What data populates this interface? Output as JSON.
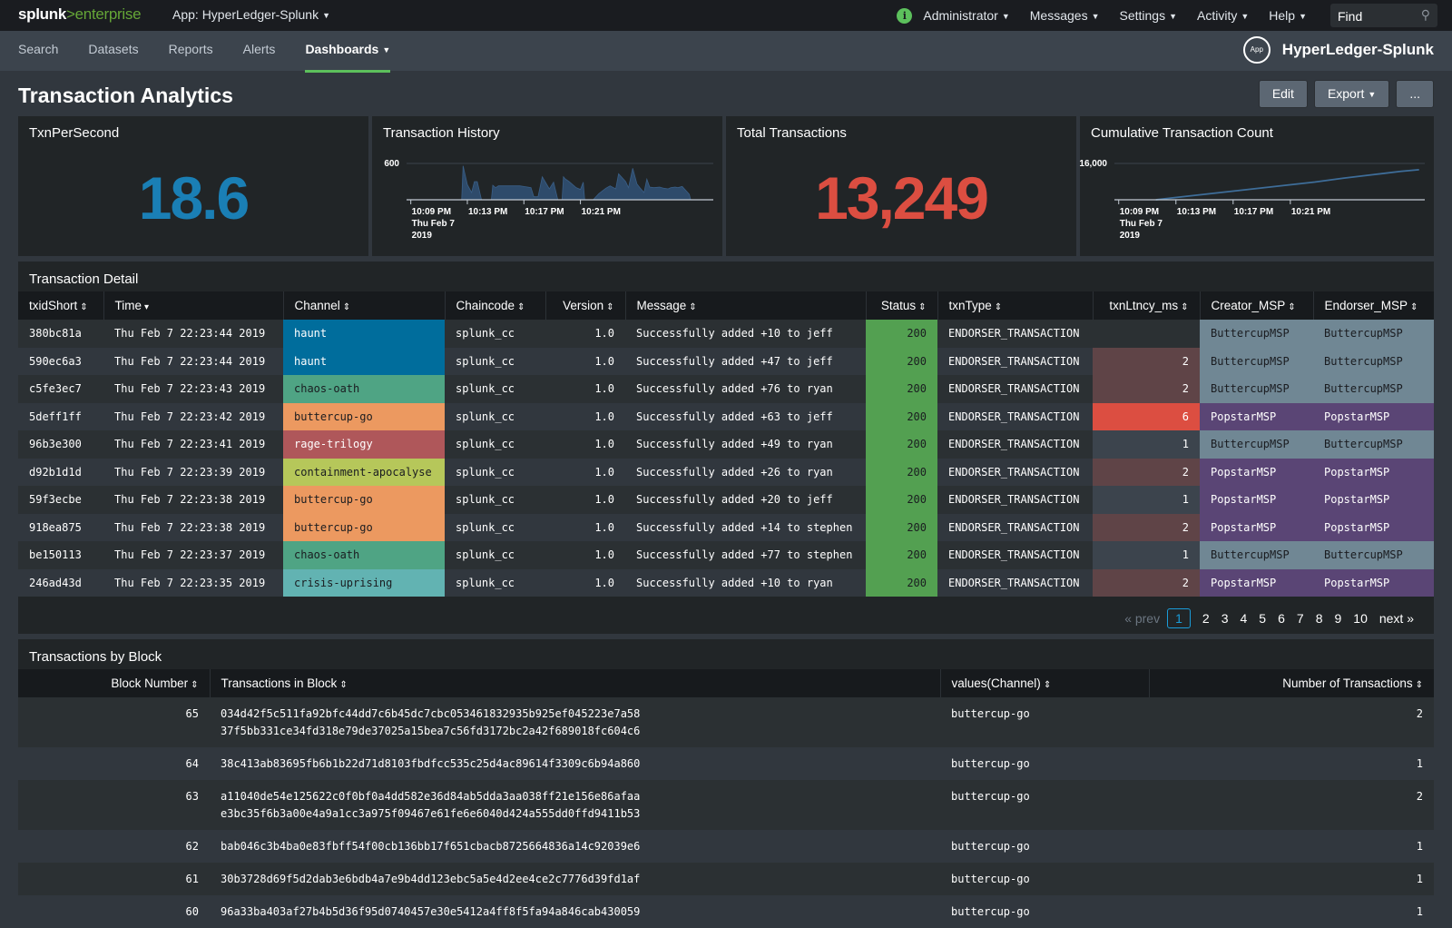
{
  "topbar": {
    "logo_main": "splunk",
    "logo_sep": ">",
    "logo_product": "enterprise",
    "app_switcher": "App: HyperLedger-Splunk",
    "nav": [
      "Administrator",
      "Messages",
      "Settings",
      "Activity",
      "Help"
    ],
    "find_placeholder": "Find"
  },
  "appbar": {
    "tabs": [
      "Search",
      "Datasets",
      "Reports",
      "Alerts",
      "Dashboards"
    ],
    "active_tab": "Dashboards",
    "app_badge": "App",
    "app_name": "HyperLedger-Splunk"
  },
  "dashboard": {
    "title": "Transaction Analytics",
    "buttons": {
      "edit": "Edit",
      "export": "Export",
      "more": "..."
    }
  },
  "panels": {
    "tps": {
      "title": "TxnPerSecond",
      "value": "18.6",
      "color": "#1a7fb5"
    },
    "history": {
      "title": "Transaction History"
    },
    "total": {
      "title": "Total Transactions",
      "value": "13,249",
      "color": "#dc4e41"
    },
    "cumulative": {
      "title": "Cumulative Transaction Count"
    }
  },
  "chart_data": [
    {
      "type": "area",
      "title": "Transaction History",
      "ylim": [
        0,
        600
      ],
      "yticks": [
        "600"
      ],
      "xticks": [
        [
          "10:09 PM",
          "Thu Feb 7",
          "2019"
        ],
        [
          "10:13 PM"
        ],
        [
          "10:17 PM"
        ],
        [
          "10:21 PM"
        ]
      ],
      "x_minutes": [
        0,
        3.9,
        4.0,
        4.3,
        4.6,
        4.8,
        5.0,
        5.3,
        5.5,
        6.0,
        6.1,
        6.3,
        6.5,
        7.0,
        8.0,
        8.8,
        9.0,
        9.3,
        9.6,
        9.8,
        10.1,
        10.4,
        10.7,
        11.0,
        11.1,
        11.2,
        11.5,
        12.0,
        12.3,
        12.5,
        12.6,
        13.0,
        13.2,
        13.6,
        14.1,
        14.4,
        14.8,
        15.0,
        15.5,
        15.7,
        16.0,
        16.3,
        16.5,
        16.8,
        17.0,
        17.2,
        17.5,
        17.9,
        18.2,
        18.5,
        18.7,
        19.0,
        19.2,
        19.5,
        20.0,
        20.1
      ],
      "values": [
        0,
        0,
        560,
        250,
        120,
        300,
        300,
        0,
        0,
        0,
        240,
        200,
        230,
        230,
        230,
        200,
        50,
        50,
        380,
        300,
        180,
        290,
        0,
        0,
        380,
        350,
        300,
        200,
        170,
        290,
        0,
        0,
        0,
        100,
        190,
        230,
        180,
        430,
        300,
        200,
        520,
        260,
        200,
        120,
        340,
        210,
        200,
        210,
        190,
        180,
        200,
        210,
        200,
        220,
        90,
        0
      ],
      "color": "#2e4b6b"
    },
    {
      "type": "line",
      "title": "Cumulative Transaction Count",
      "ylim": [
        0,
        16000
      ],
      "yticks": [
        "16,000"
      ],
      "xticks": [
        [
          "10:09 PM",
          "Thu Feb 7",
          "2019"
        ],
        [
          "10:13 PM"
        ],
        [
          "10:17 PM"
        ],
        [
          "10:21 PM"
        ]
      ],
      "x_minutes": [
        2.9,
        4,
        6,
        8,
        10,
        12,
        14,
        16,
        18,
        20,
        21.3
      ],
      "values": [
        0,
        800,
        2200,
        3600,
        5000,
        6400,
        7800,
        9500,
        11000,
        12500,
        13249
      ],
      "color": "#3e6d99"
    }
  ],
  "transaction_detail": {
    "title": "Transaction Detail",
    "columns": [
      "txidShort",
      "Time",
      "Channel",
      "Chaincode",
      "Version",
      "Message",
      "Status",
      "txnType",
      "txnLtncy_ms",
      "Creator_MSP",
      "Endorser_MSP"
    ],
    "rows": [
      [
        "380bc81a",
        "Thu Feb  7 22:23:44 2019",
        "haunt",
        "splunk_cc",
        "1.0",
        "Successfully added +10 to jeff",
        "200",
        "ENDORSER_TRANSACTION",
        "",
        "ButtercupMSP",
        "ButtercupMSP"
      ],
      [
        "590ec6a3",
        "Thu Feb  7 22:23:44 2019",
        "haunt",
        "splunk_cc",
        "1.0",
        "Successfully added +47 to jeff",
        "200",
        "ENDORSER_TRANSACTION",
        "2",
        "ButtercupMSP",
        "ButtercupMSP"
      ],
      [
        "c5fe3ec7",
        "Thu Feb  7 22:23:43 2019",
        "chaos-oath",
        "splunk_cc",
        "1.0",
        "Successfully added +76 to ryan",
        "200",
        "ENDORSER_TRANSACTION",
        "2",
        "ButtercupMSP",
        "ButtercupMSP"
      ],
      [
        "5deff1ff",
        "Thu Feb  7 22:23:42 2019",
        "buttercup-go",
        "splunk_cc",
        "1.0",
        "Successfully added +63 to jeff",
        "200",
        "ENDORSER_TRANSACTION",
        "6",
        "PopstarMSP",
        "PopstarMSP"
      ],
      [
        "96b3e300",
        "Thu Feb  7 22:23:41 2019",
        "rage-trilogy",
        "splunk_cc",
        "1.0",
        "Successfully added +49 to ryan",
        "200",
        "ENDORSER_TRANSACTION",
        "1",
        "ButtercupMSP",
        "ButtercupMSP"
      ],
      [
        "d92b1d1d",
        "Thu Feb  7 22:23:39 2019",
        "containment-apocalyse",
        "splunk_cc",
        "1.0",
        "Successfully added +26 to ryan",
        "200",
        "ENDORSER_TRANSACTION",
        "2",
        "PopstarMSP",
        "PopstarMSP"
      ],
      [
        "59f3ecbe",
        "Thu Feb  7 22:23:38 2019",
        "buttercup-go",
        "splunk_cc",
        "1.0",
        "Successfully added +20 to jeff",
        "200",
        "ENDORSER_TRANSACTION",
        "1",
        "PopstarMSP",
        "PopstarMSP"
      ],
      [
        "918ea875",
        "Thu Feb  7 22:23:38 2019",
        "buttercup-go",
        "splunk_cc",
        "1.0",
        "Successfully added +14 to stephen",
        "200",
        "ENDORSER_TRANSACTION",
        "2",
        "PopstarMSP",
        "PopstarMSP"
      ],
      [
        "be150113",
        "Thu Feb  7 22:23:37 2019",
        "chaos-oath",
        "splunk_cc",
        "1.0",
        "Successfully added +77 to stephen",
        "200",
        "ENDORSER_TRANSACTION",
        "1",
        "ButtercupMSP",
        "ButtercupMSP"
      ],
      [
        "246ad43d",
        "Thu Feb  7 22:23:35 2019",
        "crisis-uprising",
        "splunk_cc",
        "1.0",
        "Successfully added +10 to ryan",
        "200",
        "ENDORSER_TRANSACTION",
        "2",
        "PopstarMSP",
        "PopstarMSP"
      ]
    ],
    "channel_colors": {
      "haunt": [
        "#006d9c",
        "#ffffff"
      ],
      "chaos-oath": [
        "#4fa484",
        "#1a1c20"
      ],
      "buttercup-go": [
        "#ec9960",
        "#1a1c20"
      ],
      "rage-trilogy": [
        "#af575a",
        "#ffffff"
      ],
      "containment-apocalyse": [
        "#b6c75a",
        "#1a1c20"
      ],
      "crisis-uprising": [
        "#62b3b2",
        "#1a1c20"
      ]
    },
    "status_color": "#53a051",
    "latency_colors": {
      "1": "#3c444d",
      "2": "#5f4447",
      "6": "#dc4e41"
    },
    "msp_colors": {
      "ButtercupMSP": [
        "#708794",
        "#1a1c20"
      ],
      "PopstarMSP": [
        "#5a4575",
        "#ffffff"
      ]
    },
    "pagination": {
      "prev": "« prev",
      "pages": [
        "1",
        "2",
        "3",
        "4",
        "5",
        "6",
        "7",
        "8",
        "9",
        "10"
      ],
      "current": "1",
      "next": "next »"
    }
  },
  "transactions_by_block": {
    "title": "Transactions by Block",
    "columns": [
      "Block Number",
      "Transactions in Block",
      "values(Channel)",
      "Number of Transactions"
    ],
    "rows": [
      {
        "block": "65",
        "txns": [
          "034d42f5c511fa92bfc44dd7c6b45dc7cbc053461832935b925ef045223e7a58",
          "37f5bb331ce34fd318e79de37025a15bea7c56fd3172bc2a42f689018fc604c6"
        ],
        "channel": "buttercup-go",
        "count": "2"
      },
      {
        "block": "64",
        "txns": [
          "38c413ab83695fb6b1b22d71d8103fbdfcc535c25d4ac89614f3309c6b94a860"
        ],
        "channel": "buttercup-go",
        "count": "1"
      },
      {
        "block": "63",
        "txns": [
          "a11040de54e125622c0f0bf0a4dd582e36d84ab5dda3aa038ff21e156e86afaa",
          "e3bc35f6b3a00e4a9a1cc3a975f09467e61fe6e6040d424a555dd0ffd9411b53"
        ],
        "channel": "buttercup-go",
        "count": "2"
      },
      {
        "block": "62",
        "txns": [
          "bab046c3b4ba0e83fbff54f00cb136bb17f651cbacb8725664836a14c92039e6"
        ],
        "channel": "buttercup-go",
        "count": "1"
      },
      {
        "block": "61",
        "txns": [
          "30b3728d69f5d2dab3e6bdb4a7e9b4dd123ebc5a5e4d2ee4ce2c7776d39fd1af"
        ],
        "channel": "buttercup-go",
        "count": "1"
      },
      {
        "block": "60",
        "txns": [
          "96a33ba403af27b4b5d36f95d0740457e30e5412a4ff8f5fa94a846cab430059"
        ],
        "channel": "buttercup-go",
        "count": "1"
      }
    ]
  }
}
